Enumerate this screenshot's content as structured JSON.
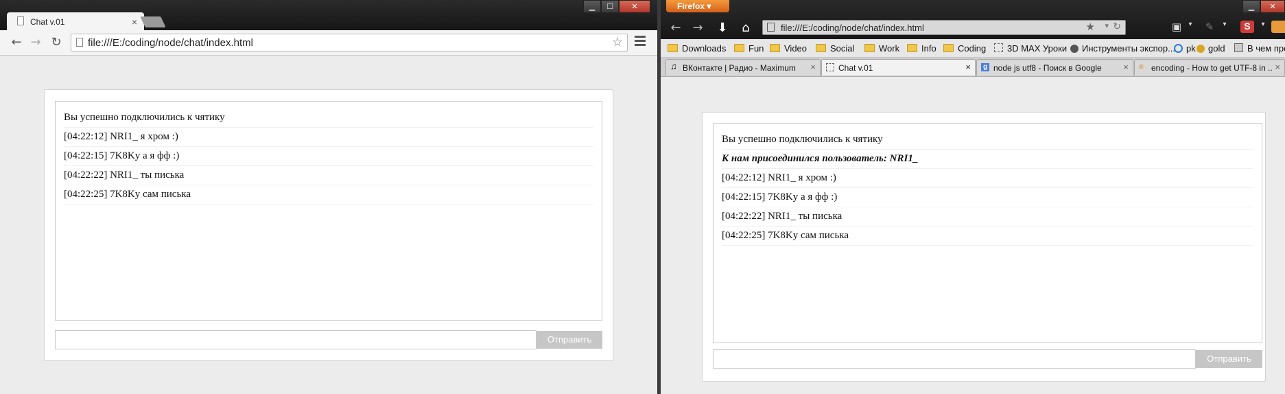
{
  "chrome": {
    "tab_title": "Chat v.01",
    "url": "file:///E:/coding/node/chat/index.html",
    "win_min": "▁",
    "win_max": "☐",
    "win_close": "✕",
    "tab_close": "×",
    "nav_back": "←",
    "nav_forward": "→",
    "nav_reload": "↻",
    "star": "☆"
  },
  "firefox": {
    "app_button": "Firefox",
    "url": "file:///E:/coding/node/chat/index.html",
    "win_min": "▁",
    "win_max": "☐",
    "win_close": "✕",
    "bookmarks": [
      "Downloads",
      "Fun",
      "Video",
      "Social",
      "Work",
      "Info",
      "Coding",
      "3D MAX Уроки",
      "Инструменты экспор...",
      "pk",
      "gold",
      "В чем проблема «пр"
    ],
    "tabs": [
      {
        "title": "ВКонтакте | Радио - Maximum"
      },
      {
        "title": "Chat v.01"
      },
      {
        "title": "node js utf8 - Поиск в Google"
      },
      {
        "title": "encoding - How to get UTF-8 in ..."
      }
    ],
    "tab_close": "×"
  },
  "chat_chrome": {
    "messages": [
      "Вы успешно подключились к чятику",
      "[04:22:12] NRI1_ я хром :)",
      "[04:22:15] 7K8Ky а я фф :)",
      "[04:22:22] NRI1_ ты писька",
      "[04:22:25] 7K8Ky сам писька"
    ],
    "send_label": "Отправить"
  },
  "chat_firefox": {
    "messages": [
      "Вы успешно подключились к чятику",
      "К нам присоединился пользователь: NRI1_",
      "[04:22:12] NRI1_ я хром :)",
      "[04:22:15] 7K8Ky а я фф :)",
      "[04:22:22] NRI1_ ты писька",
      "[04:22:25] 7K8Ky сам писька"
    ],
    "send_label": "Отправить"
  },
  "colors": {
    "page_bg": "#ececec",
    "button_bg": "#c6c6c6",
    "firefox_orange": "#e07a2a"
  }
}
